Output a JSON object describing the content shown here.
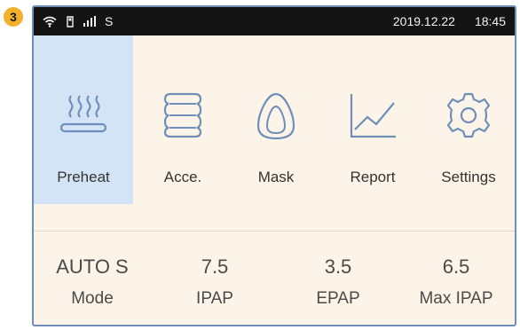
{
  "badge": "3",
  "status_bar": {
    "network": "S",
    "date": "2019.12.22",
    "time": "18:45"
  },
  "menu": {
    "items": [
      {
        "label": "Preheat",
        "icon": "heater-icon",
        "selected": true
      },
      {
        "label": "Acce.",
        "icon": "accessory-icon",
        "selected": false
      },
      {
        "label": "Mask",
        "icon": "mask-icon",
        "selected": false
      },
      {
        "label": "Report",
        "icon": "report-chart-icon",
        "selected": false
      },
      {
        "label": "Settings",
        "icon": "gear-icon",
        "selected": false
      }
    ]
  },
  "stats": [
    {
      "value": "AUTO S",
      "label": "Mode"
    },
    {
      "value": "7.5",
      "label": "IPAP"
    },
    {
      "value": "3.5",
      "label": "EPAP"
    },
    {
      "value": "6.5",
      "label": "Max IPAP"
    }
  ],
  "colors": {
    "icon_stroke": "#6f8fb8",
    "selected_bg": "#d4e4f7",
    "screen_bg": "#fcf4e8",
    "status_bg": "#141414",
    "badge": "#f3b02a"
  }
}
